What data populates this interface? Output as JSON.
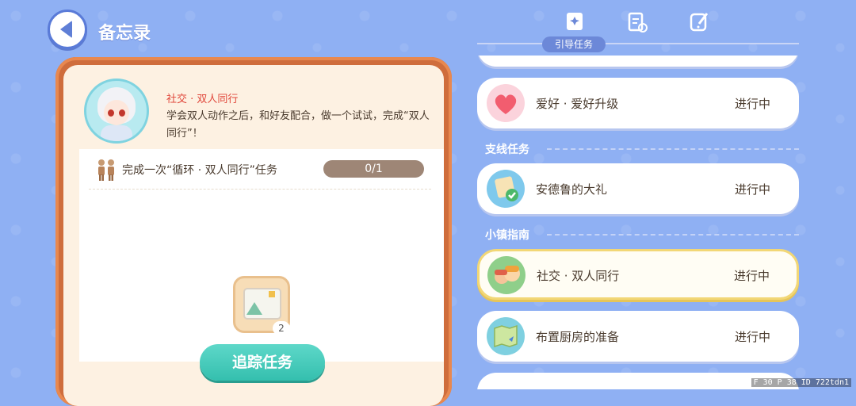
{
  "header": {
    "title": "备忘录"
  },
  "task_detail": {
    "name": "社交 · 双人同行",
    "description": "学会双人动作之后，和好友配合，做一个试试，完成“双人同行”！",
    "objective": "完成一次“循环 · 双人同行”任务",
    "progress": "0/1",
    "reward_count": "2",
    "track_button": "追踪任务"
  },
  "tabs": {
    "active_label": "引导任务"
  },
  "sections": {
    "side": "支线任务",
    "town": "小镇指南"
  },
  "items": [
    {
      "label": "爱好 · 爱好升级",
      "status": "进行中"
    },
    {
      "label": "安德鲁的大礼",
      "status": "进行中"
    },
    {
      "label": "社交 · 双人同行",
      "status": "进行中"
    },
    {
      "label": "布置厨房的准备",
      "status": "进行中"
    }
  ],
  "debug": {
    "text": "F 30   P 38   ID 722tdn1"
  },
  "colors": {
    "background": "#8fb0f3",
    "card_frame": "#cf6d3c",
    "track_button": "#3cc8b6",
    "task_name": "#e0463a"
  }
}
